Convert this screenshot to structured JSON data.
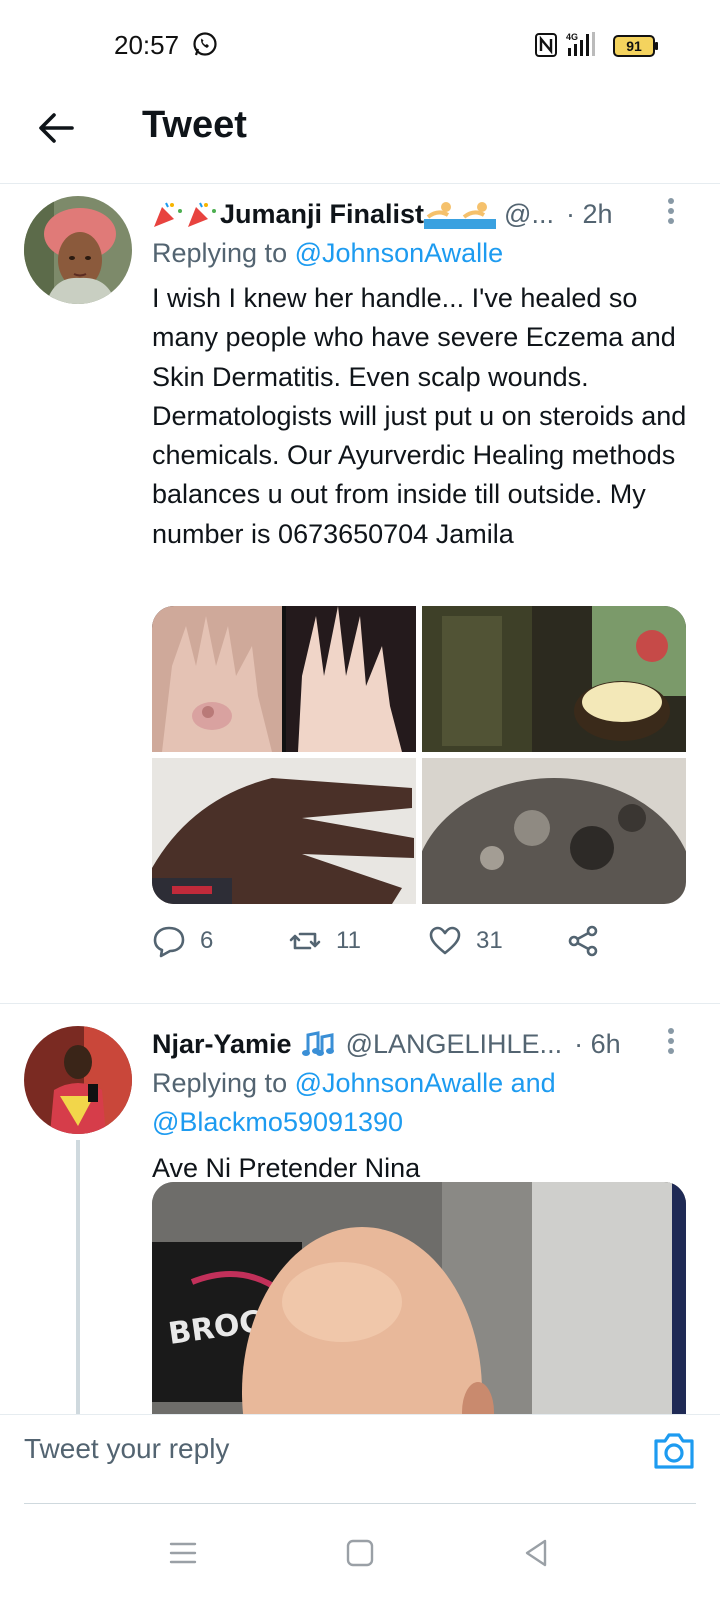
{
  "status_bar": {
    "time": "20:57",
    "network": "4G",
    "battery": "91"
  },
  "header": {
    "title": "Tweet"
  },
  "tweets": [
    {
      "name": "Jumanji Finalist",
      "handle": "@...",
      "time": "· 2h",
      "reply_label": "Replying to",
      "reply_mentions": "@JohnsonAwalle",
      "text": "I wish I knew her handle... I've healed so many people who have severe Eczema and Skin Dermatitis. Even scalp wounds. Dermatologists will just put u on steroids and chemicals. Our Ayurverdic Healing methods balances u out from inside till outside. My number is 0673650704 Jamila",
      "stats": {
        "replies": "6",
        "retweets": "11",
        "likes": "31"
      }
    },
    {
      "name": "Njar-Yamie",
      "handle": "@LANGELIHLE...",
      "time": "· 6h",
      "reply_label": "Replying to",
      "reply_mentions": "@JohnsonAwalle and @Blackmo59091390",
      "text": "Ave Ni Pretender Nina",
      "image_sign_text": "BROCKL"
    }
  ],
  "composer": {
    "placeholder": "Tweet your reply"
  },
  "colors": {
    "accent": "#1d9bf0",
    "text": "#0f1419",
    "secondary": "#536471",
    "divider": "#e6ecf0"
  }
}
